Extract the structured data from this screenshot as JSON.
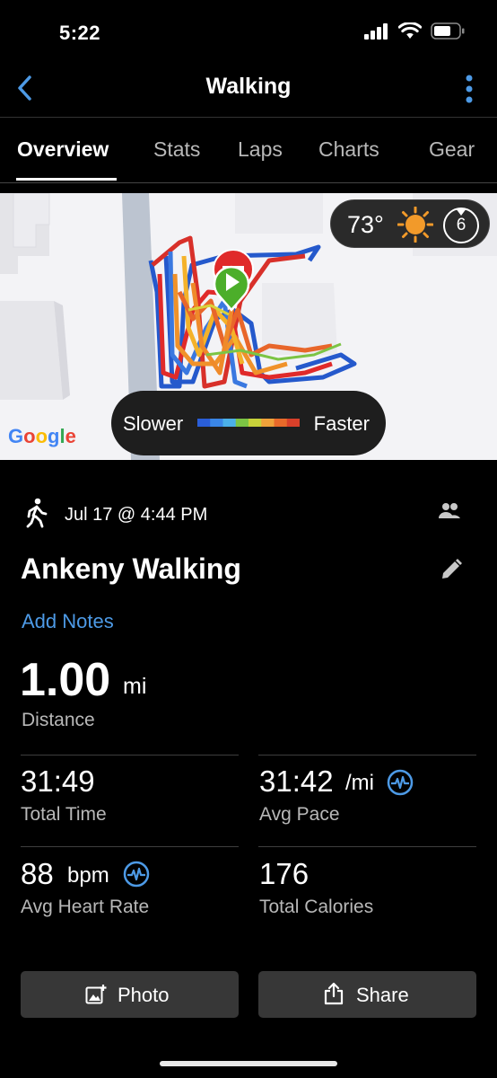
{
  "status": {
    "time": "5:22"
  },
  "nav": {
    "title": "Walking"
  },
  "tabs": [
    {
      "label": "Overview"
    },
    {
      "label": "Stats"
    },
    {
      "label": "Laps"
    },
    {
      "label": "Charts"
    },
    {
      "label": "Gear"
    }
  ],
  "map": {
    "temperature": "73°",
    "wind_speed": "6",
    "legend_slow": "Slower",
    "legend_fast": "Faster",
    "legend_colors": [
      "#2a5ed8",
      "#3a86e6",
      "#4bb0e8",
      "#7cc444",
      "#c8d23a",
      "#f0a23a",
      "#e96a2a",
      "#d8402a"
    ],
    "attribution": {
      "letters": [
        "G",
        "o",
        "o",
        "g",
        "l",
        "e"
      ],
      "colors": [
        "#4285f4",
        "#ea4335",
        "#fbbc05",
        "#4285f4",
        "#34a853",
        "#ea4335"
      ]
    }
  },
  "activity": {
    "date": "Jul 17 @ 4:44 PM",
    "title": "Ankeny Walking",
    "add_notes": "Add Notes"
  },
  "distance": {
    "value": "1.00",
    "unit": "mi",
    "label": "Distance"
  },
  "stats": {
    "total_time": {
      "value": "31:49",
      "label": "Total Time"
    },
    "avg_pace": {
      "value": "31:42",
      "unit": "/mi",
      "label": "Avg Pace"
    },
    "avg_heart_rate": {
      "value": "88",
      "unit": "bpm",
      "label": "Avg Heart Rate"
    },
    "total_calories": {
      "value": "176",
      "label": "Total Calories"
    }
  },
  "buttons": {
    "photo": "Photo",
    "share": "Share"
  },
  "colors": {
    "accent": "#4d9ae6",
    "background": "#000000",
    "button": "#373737"
  }
}
